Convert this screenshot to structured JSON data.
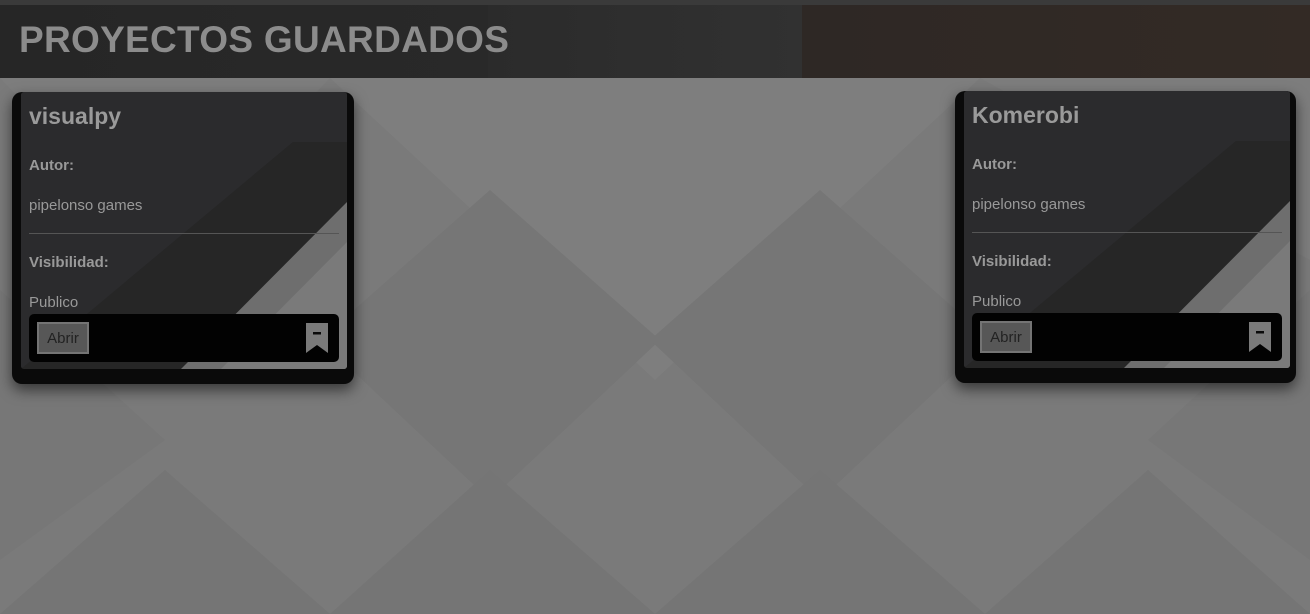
{
  "page": {
    "title": "PROYECTOS GUARDADOS"
  },
  "projects": [
    {
      "name": "visualpy",
      "author_label": "Autor:",
      "author": "pipelonso games",
      "visibility_label": "Visibilidad:",
      "visibility": "Publico",
      "open_label": "Abrir",
      "bookmark_icon": "bookmark-remove-icon"
    },
    {
      "name": "Komerobi",
      "author_label": "Autor:",
      "author": "pipelonso games",
      "visibility_label": "Visibilidad:",
      "visibility": "Publico",
      "open_label": "Abrir",
      "bookmark_icon": "bookmark-remove-icon"
    }
  ],
  "colors": {
    "background": "#7a7a7a",
    "header": "#262626",
    "card": "#262626",
    "footer": "#020202",
    "title_text": "#8c8c8c"
  }
}
